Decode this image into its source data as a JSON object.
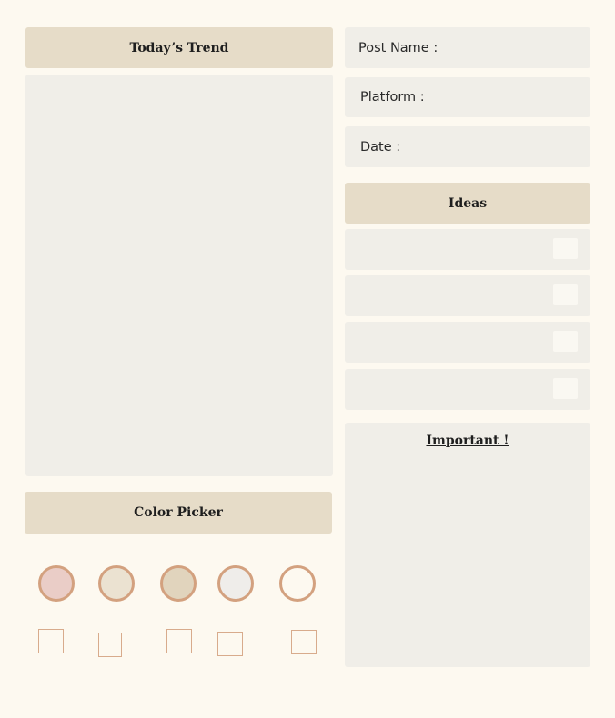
{
  "trend": {
    "title": "Today’s Trend"
  },
  "color_picker": {
    "title": "Color Picker",
    "swatches": [
      "#eacdc7",
      "#ebe2d1",
      "#e1d4bd",
      "#efedea",
      "#fdf9f0"
    ],
    "swatch_border": "#d3a17f"
  },
  "fields": {
    "post_name": "Post Name :",
    "platform": "Platform :",
    "date": "Date :"
  },
  "ideas": {
    "title": "Ideas"
  },
  "important": {
    "title": "Important !"
  },
  "colors": {
    "background": "#fdf9f0",
    "header": "#e6dcc8",
    "panel": "#f0eee8"
  }
}
